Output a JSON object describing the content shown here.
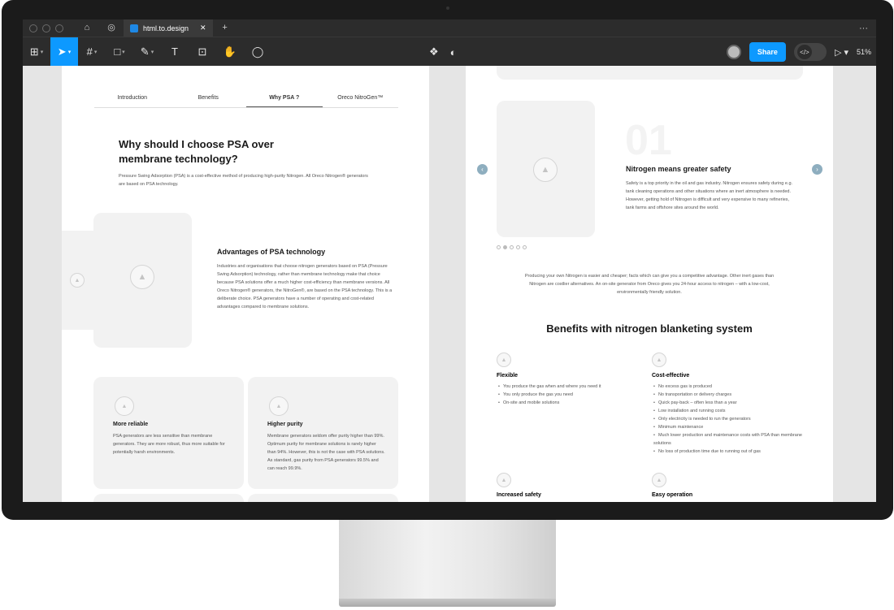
{
  "tabbar": {
    "tab_title": "html.to.design",
    "plus": "+",
    "more": "···"
  },
  "toolbar": {
    "share_label": "Share",
    "zoom_label": "51%",
    "text_tool": "T"
  },
  "left_frame": {
    "nav": [
      "Introduction",
      "Benefits",
      "Why PSA ?",
      "Oreco NitroGen™"
    ],
    "title": "Why should I choose PSA over membrane technology?",
    "intro": "Pressure Swing Adsorption (PSA) is a cost-effective method of producing high-purity Nitrogen. All Oreco Nitrogen® generators are based on PSA technology.",
    "advantages_title": "Advantages of PSA technology",
    "advantages_text": "Industries and organisations that choose nitrogen generators based on PSA (Pressure Swing Adsorption) technology, rather than membrane technology make that choice because PSA solutions offer a much higher cost-efficiency than membrane versions. All Oreco Nitrogen® generators, the NitroGen®, are based on the PSA technology. This is a deliberate choice. PSA generators have a number of operating and cost-related advantages compared to membrane solutions.",
    "cards": [
      {
        "title": "More reliable",
        "text": "PSA generators are less sensitive than membrane generators. They are more robust, thus more suitable for potentially harsh environments."
      },
      {
        "title": "Higher purity",
        "text": "Membrane generators seldom offer purity higher than 99%. Optimum purity for membrane solutions is rarely higher than 94%. However, this is not the case with PSA solutions. As standard, gas purity from PSA generators 99.5% and can reach 99.9%."
      }
    ]
  },
  "right_frame": {
    "slide_number": "01",
    "slide_title": "Nitrogen means greater safety",
    "slide_text": "Safety is a top priority in the oil and gas industry. Nitrogen ensures safety during e.g. tank cleaning operations and other situations where an inert atmosphere is needed. However, getting hold of Nitrogen is difficult and very expensive to many refineries, tank farms and offshore sites around the world.",
    "summary": "Producing your own Nitrogen is easier and cheaper; facts which can give you a competitive advantage. Other inert gases than Nitrogen are costlier alternatives. An on-site generator from Oreco gives you 24-hour access to nitrogen – with a low-cost, environmentally friendly solution.",
    "benefits_title": "Benefits with nitrogen blanketing system",
    "benefits": [
      {
        "title": "Flexible",
        "items": [
          "You produce the gas when and where you need it",
          "You only produce the gas you need",
          "On-site and mobile solutions"
        ]
      },
      {
        "title": "Cost-effective",
        "items": [
          "No excess gas is produced",
          "No transportation or delivery charges",
          "Quick pay-back – often less than a year",
          "Low installation and running costs",
          "Only electricity is needed to run the generators",
          "Minimum maintenance",
          "Much lower production and maintenance costs with PSA than membrane solutions",
          "No loss of production time due to running out of gas"
        ]
      },
      {
        "title": "Increased safety",
        "items": []
      },
      {
        "title": "Easy operation",
        "items": []
      }
    ]
  }
}
